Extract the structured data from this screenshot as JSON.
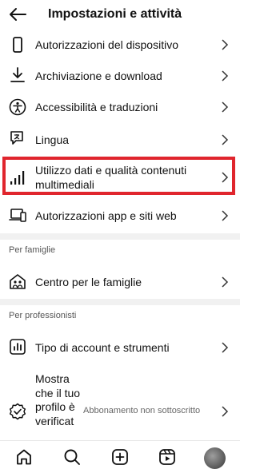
{
  "header": {
    "title": "Impostazioni e attività",
    "back_icon": "arrow-left-icon"
  },
  "settings": {
    "device_permissions": {
      "label": "Autorizzazioni del dispositivo",
      "icon": "phone-icon"
    },
    "archive_download": {
      "label": "Archiviazione e download",
      "icon": "download-icon"
    },
    "accessibility": {
      "label": "Accessibilità e traduzioni",
      "icon": "accessibility-icon"
    },
    "language": {
      "label": "Lingua",
      "icon": "translate-icon"
    },
    "data_usage": {
      "label_line1": "Utilizzo dati e qualità contenuti",
      "label_line2": "multimediali",
      "icon": "signal-bars-icon"
    },
    "app_permissions": {
      "label": "Autorizzazioni app e siti web",
      "icon": "devices-icon"
    }
  },
  "family_section": {
    "title": "Per famiglie",
    "family_center": {
      "label": "Centro per le famiglie",
      "icon": "family-home-icon"
    }
  },
  "pro_section": {
    "title": "Per professionisti",
    "account_type": {
      "label": "Tipo di account e strumenti",
      "icon": "chart-icon"
    },
    "verified": {
      "label": "Mostra che il tuo profilo è verificat",
      "status": "Abbonamento non sottoscritto",
      "icon": "verified-badge-icon"
    }
  },
  "bottom_nav": {
    "items": [
      "home-icon",
      "search-icon",
      "create-icon",
      "reels-icon",
      "profile-avatar"
    ]
  },
  "colors": {
    "highlight": "#e0252d",
    "divider": "#f1f1f1"
  }
}
